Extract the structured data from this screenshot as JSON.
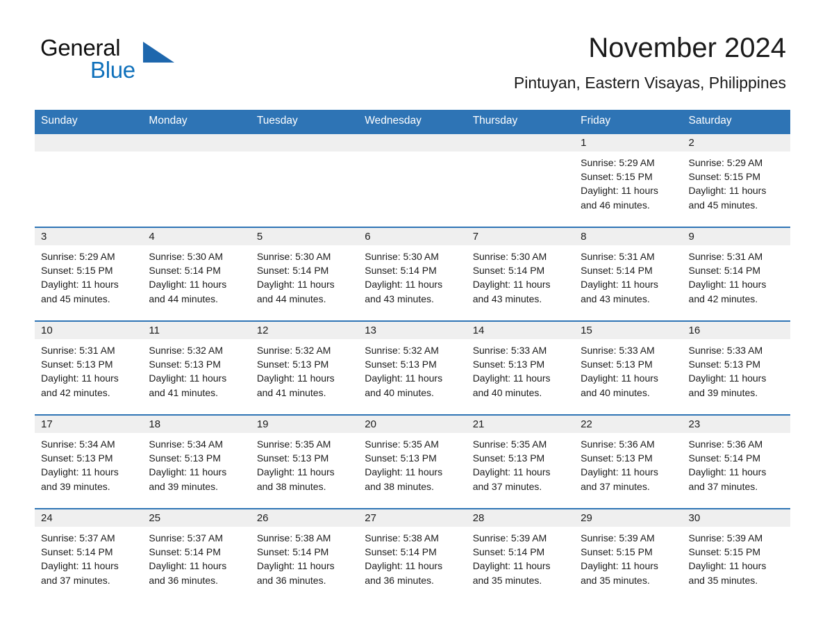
{
  "brand": {
    "name_line1": "General",
    "name_line2": "Blue",
    "logo_icon": "blue-triangle-icon"
  },
  "header": {
    "title": "November 2024",
    "subtitle": "Pintuyan, Eastern Visayas, Philippines"
  },
  "colors": {
    "header_blue": "#2e74b5",
    "brand_blue": "#1071bb",
    "daynum_bg": "#efefef",
    "text": "#1a1a1a"
  },
  "weekday_headers": [
    "Sunday",
    "Monday",
    "Tuesday",
    "Wednesday",
    "Thursday",
    "Friday",
    "Saturday"
  ],
  "weeks": [
    [
      {
        "day": "",
        "empty": true,
        "sunrise": "",
        "sunset": "",
        "daylight_line1": "",
        "daylight_line2": ""
      },
      {
        "day": "",
        "empty": true,
        "sunrise": "",
        "sunset": "",
        "daylight_line1": "",
        "daylight_line2": ""
      },
      {
        "day": "",
        "empty": true,
        "sunrise": "",
        "sunset": "",
        "daylight_line1": "",
        "daylight_line2": ""
      },
      {
        "day": "",
        "empty": true,
        "sunrise": "",
        "sunset": "",
        "daylight_line1": "",
        "daylight_line2": ""
      },
      {
        "day": "",
        "empty": true,
        "sunrise": "",
        "sunset": "",
        "daylight_line1": "",
        "daylight_line2": ""
      },
      {
        "day": "1",
        "empty": false,
        "sunrise": "Sunrise: 5:29 AM",
        "sunset": "Sunset: 5:15 PM",
        "daylight_line1": "Daylight: 11 hours",
        "daylight_line2": "and 46 minutes."
      },
      {
        "day": "2",
        "empty": false,
        "sunrise": "Sunrise: 5:29 AM",
        "sunset": "Sunset: 5:15 PM",
        "daylight_line1": "Daylight: 11 hours",
        "daylight_line2": "and 45 minutes."
      }
    ],
    [
      {
        "day": "3",
        "empty": false,
        "sunrise": "Sunrise: 5:29 AM",
        "sunset": "Sunset: 5:15 PM",
        "daylight_line1": "Daylight: 11 hours",
        "daylight_line2": "and 45 minutes."
      },
      {
        "day": "4",
        "empty": false,
        "sunrise": "Sunrise: 5:30 AM",
        "sunset": "Sunset: 5:14 PM",
        "daylight_line1": "Daylight: 11 hours",
        "daylight_line2": "and 44 minutes."
      },
      {
        "day": "5",
        "empty": false,
        "sunrise": "Sunrise: 5:30 AM",
        "sunset": "Sunset: 5:14 PM",
        "daylight_line1": "Daylight: 11 hours",
        "daylight_line2": "and 44 minutes."
      },
      {
        "day": "6",
        "empty": false,
        "sunrise": "Sunrise: 5:30 AM",
        "sunset": "Sunset: 5:14 PM",
        "daylight_line1": "Daylight: 11 hours",
        "daylight_line2": "and 43 minutes."
      },
      {
        "day": "7",
        "empty": false,
        "sunrise": "Sunrise: 5:30 AM",
        "sunset": "Sunset: 5:14 PM",
        "daylight_line1": "Daylight: 11 hours",
        "daylight_line2": "and 43 minutes."
      },
      {
        "day": "8",
        "empty": false,
        "sunrise": "Sunrise: 5:31 AM",
        "sunset": "Sunset: 5:14 PM",
        "daylight_line1": "Daylight: 11 hours",
        "daylight_line2": "and 43 minutes."
      },
      {
        "day": "9",
        "empty": false,
        "sunrise": "Sunrise: 5:31 AM",
        "sunset": "Sunset: 5:14 PM",
        "daylight_line1": "Daylight: 11 hours",
        "daylight_line2": "and 42 minutes."
      }
    ],
    [
      {
        "day": "10",
        "empty": false,
        "sunrise": "Sunrise: 5:31 AM",
        "sunset": "Sunset: 5:13 PM",
        "daylight_line1": "Daylight: 11 hours",
        "daylight_line2": "and 42 minutes."
      },
      {
        "day": "11",
        "empty": false,
        "sunrise": "Sunrise: 5:32 AM",
        "sunset": "Sunset: 5:13 PM",
        "daylight_line1": "Daylight: 11 hours",
        "daylight_line2": "and 41 minutes."
      },
      {
        "day": "12",
        "empty": false,
        "sunrise": "Sunrise: 5:32 AM",
        "sunset": "Sunset: 5:13 PM",
        "daylight_line1": "Daylight: 11 hours",
        "daylight_line2": "and 41 minutes."
      },
      {
        "day": "13",
        "empty": false,
        "sunrise": "Sunrise: 5:32 AM",
        "sunset": "Sunset: 5:13 PM",
        "daylight_line1": "Daylight: 11 hours",
        "daylight_line2": "and 40 minutes."
      },
      {
        "day": "14",
        "empty": false,
        "sunrise": "Sunrise: 5:33 AM",
        "sunset": "Sunset: 5:13 PM",
        "daylight_line1": "Daylight: 11 hours",
        "daylight_line2": "and 40 minutes."
      },
      {
        "day": "15",
        "empty": false,
        "sunrise": "Sunrise: 5:33 AM",
        "sunset": "Sunset: 5:13 PM",
        "daylight_line1": "Daylight: 11 hours",
        "daylight_line2": "and 40 minutes."
      },
      {
        "day": "16",
        "empty": false,
        "sunrise": "Sunrise: 5:33 AM",
        "sunset": "Sunset: 5:13 PM",
        "daylight_line1": "Daylight: 11 hours",
        "daylight_line2": "and 39 minutes."
      }
    ],
    [
      {
        "day": "17",
        "empty": false,
        "sunrise": "Sunrise: 5:34 AM",
        "sunset": "Sunset: 5:13 PM",
        "daylight_line1": "Daylight: 11 hours",
        "daylight_line2": "and 39 minutes."
      },
      {
        "day": "18",
        "empty": false,
        "sunrise": "Sunrise: 5:34 AM",
        "sunset": "Sunset: 5:13 PM",
        "daylight_line1": "Daylight: 11 hours",
        "daylight_line2": "and 39 minutes."
      },
      {
        "day": "19",
        "empty": false,
        "sunrise": "Sunrise: 5:35 AM",
        "sunset": "Sunset: 5:13 PM",
        "daylight_line1": "Daylight: 11 hours",
        "daylight_line2": "and 38 minutes."
      },
      {
        "day": "20",
        "empty": false,
        "sunrise": "Sunrise: 5:35 AM",
        "sunset": "Sunset: 5:13 PM",
        "daylight_line1": "Daylight: 11 hours",
        "daylight_line2": "and 38 minutes."
      },
      {
        "day": "21",
        "empty": false,
        "sunrise": "Sunrise: 5:35 AM",
        "sunset": "Sunset: 5:13 PM",
        "daylight_line1": "Daylight: 11 hours",
        "daylight_line2": "and 37 minutes."
      },
      {
        "day": "22",
        "empty": false,
        "sunrise": "Sunrise: 5:36 AM",
        "sunset": "Sunset: 5:13 PM",
        "daylight_line1": "Daylight: 11 hours",
        "daylight_line2": "and 37 minutes."
      },
      {
        "day": "23",
        "empty": false,
        "sunrise": "Sunrise: 5:36 AM",
        "sunset": "Sunset: 5:14 PM",
        "daylight_line1": "Daylight: 11 hours",
        "daylight_line2": "and 37 minutes."
      }
    ],
    [
      {
        "day": "24",
        "empty": false,
        "sunrise": "Sunrise: 5:37 AM",
        "sunset": "Sunset: 5:14 PM",
        "daylight_line1": "Daylight: 11 hours",
        "daylight_line2": "and 37 minutes."
      },
      {
        "day": "25",
        "empty": false,
        "sunrise": "Sunrise: 5:37 AM",
        "sunset": "Sunset: 5:14 PM",
        "daylight_line1": "Daylight: 11 hours",
        "daylight_line2": "and 36 minutes."
      },
      {
        "day": "26",
        "empty": false,
        "sunrise": "Sunrise: 5:38 AM",
        "sunset": "Sunset: 5:14 PM",
        "daylight_line1": "Daylight: 11 hours",
        "daylight_line2": "and 36 minutes."
      },
      {
        "day": "27",
        "empty": false,
        "sunrise": "Sunrise: 5:38 AM",
        "sunset": "Sunset: 5:14 PM",
        "daylight_line1": "Daylight: 11 hours",
        "daylight_line2": "and 36 minutes."
      },
      {
        "day": "28",
        "empty": false,
        "sunrise": "Sunrise: 5:39 AM",
        "sunset": "Sunset: 5:14 PM",
        "daylight_line1": "Daylight: 11 hours",
        "daylight_line2": "and 35 minutes."
      },
      {
        "day": "29",
        "empty": false,
        "sunrise": "Sunrise: 5:39 AM",
        "sunset": "Sunset: 5:15 PM",
        "daylight_line1": "Daylight: 11 hours",
        "daylight_line2": "and 35 minutes."
      },
      {
        "day": "30",
        "empty": false,
        "sunrise": "Sunrise: 5:39 AM",
        "sunset": "Sunset: 5:15 PM",
        "daylight_line1": "Daylight: 11 hours",
        "daylight_line2": "and 35 minutes."
      }
    ]
  ]
}
